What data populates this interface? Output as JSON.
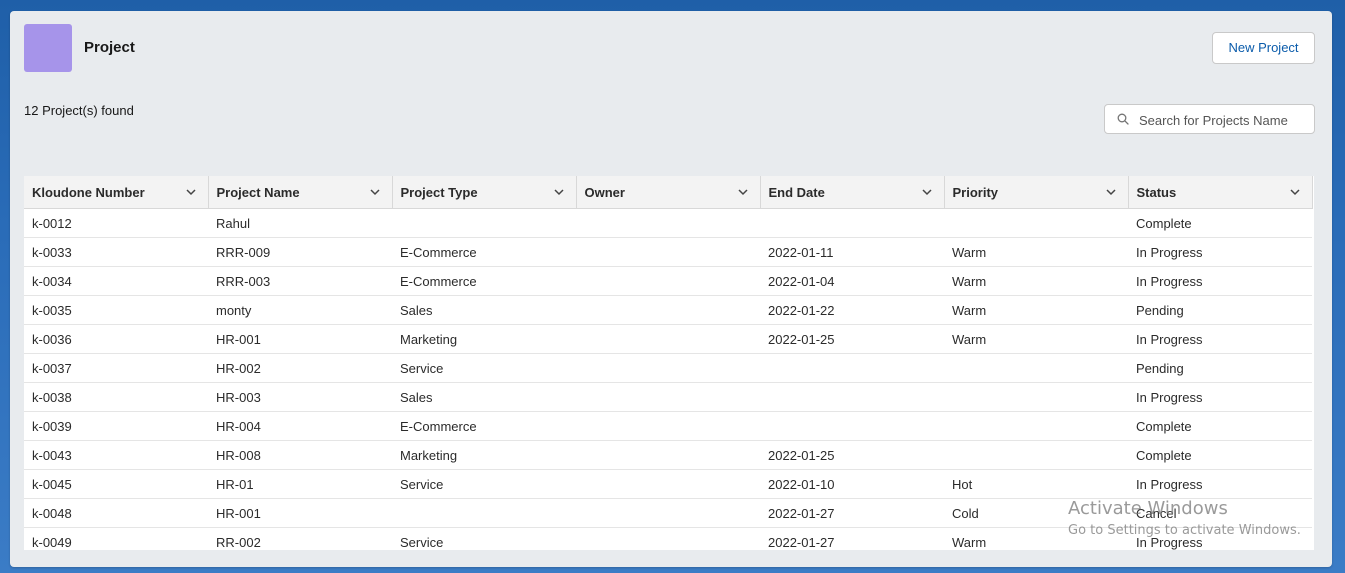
{
  "header": {
    "title": "Project",
    "new_button_label": "New Project",
    "icon_color": "#a694ea"
  },
  "summary": {
    "count_text": "12 Project(s) found"
  },
  "search": {
    "placeholder": "Search for Projects Name",
    "value": ""
  },
  "table": {
    "columns": [
      "Kloudone Number",
      "Project Name",
      "Project Type",
      "Owner",
      "End Date",
      "Priority",
      "Status"
    ],
    "rows": [
      [
        "k-0012",
        "Rahul",
        "",
        "",
        "",
        "",
        "Complete"
      ],
      [
        "k-0033",
        "RRR-009",
        "E-Commerce",
        "",
        "2022-01-11",
        "Warm",
        "In Progress"
      ],
      [
        "k-0034",
        "RRR-003",
        "E-Commerce",
        "",
        "2022-01-04",
        "Warm",
        "In Progress"
      ],
      [
        "k-0035",
        "monty",
        "Sales",
        "",
        "2022-01-22",
        "Warm",
        "Pending"
      ],
      [
        "k-0036",
        "HR-001",
        "Marketing",
        "",
        "2022-01-25",
        "Warm",
        "In Progress"
      ],
      [
        "k-0037",
        "HR-002",
        "Service",
        "",
        "",
        "",
        "Pending"
      ],
      [
        "k-0038",
        "HR-003",
        "Sales",
        "",
        "",
        "",
        "In Progress"
      ],
      [
        "k-0039",
        "HR-004",
        "E-Commerce",
        "",
        "",
        "",
        "Complete"
      ],
      [
        "k-0043",
        "HR-008",
        "Marketing",
        "",
        "2022-01-25",
        "",
        "Complete"
      ],
      [
        "k-0045",
        "HR-01",
        "Service",
        "",
        "2022-01-10",
        "Hot",
        "In Progress"
      ],
      [
        "k-0048",
        "HR-001",
        "",
        "",
        "2022-01-27",
        "Cold",
        "Cancel"
      ],
      [
        "k-0049",
        "RR-002",
        "Service",
        "",
        "2022-01-27",
        "Warm",
        "In Progress"
      ]
    ]
  },
  "watermark": {
    "line1": "Activate Windows",
    "line2": "Go to Settings to activate Windows."
  }
}
